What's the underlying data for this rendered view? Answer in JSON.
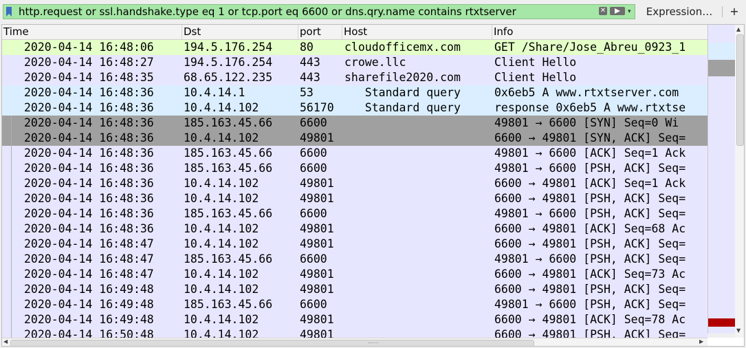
{
  "filter": {
    "value": "http.request or ssl.handshake.type eq 1 or tcp.port eq 6600 or dns.qry.name contains rtxtserver",
    "expression_label": "Expression…",
    "add_label": "+"
  },
  "columns": [
    "Time",
    "Dst",
    "port",
    "Host",
    "Info"
  ],
  "colors": {
    "http": "#e4ffc7",
    "default": "#e7e6ff",
    "dns": "#daeeff",
    "selected": "#a0a0a0",
    "filter_valid": "#a6e6a6",
    "minimap_marker": "#b00000"
  },
  "rows": [
    {
      "time": "2020-04-14 16:48:06",
      "dst": "194.5.176.254",
      "port": "80",
      "host": "cloudofficemx.com",
      "info": "GET /Share/Jose_Abreu_0923_1",
      "color": "http"
    },
    {
      "time": "2020-04-14 16:48:27",
      "dst": "194.5.176.254",
      "port": "443",
      "host": "crowe.llc",
      "info": "Client Hello",
      "color": "default"
    },
    {
      "time": "2020-04-14 16:48:35",
      "dst": "68.65.122.235",
      "port": "443",
      "host": "sharefile2020.com",
      "info": "Client Hello",
      "color": "default"
    },
    {
      "time": "2020-04-14 16:48:36",
      "dst": "10.4.14.1",
      "port": "53",
      "host": "   Standard query",
      "info": "0x6eb5 A www.rtxtserver.com",
      "color": "dns"
    },
    {
      "time": "2020-04-14 16:48:36",
      "dst": "10.4.14.102",
      "port": "56170",
      "host": "   Standard query",
      "info": "response 0x6eb5 A www.rtxtse",
      "color": "dns"
    },
    {
      "time": "2020-04-14 16:48:36",
      "dst": "185.163.45.66",
      "port": "6600",
      "host": "",
      "info": "49801 → 6600 [SYN] Seq=0 Wi",
      "color": "selected"
    },
    {
      "time": "2020-04-14 16:48:36",
      "dst": "10.4.14.102",
      "port": "49801",
      "host": "",
      "info": "6600 → 49801 [SYN, ACK] Seq=",
      "color": "selected"
    },
    {
      "time": "2020-04-14 16:48:36",
      "dst": "185.163.45.66",
      "port": "6600",
      "host": "",
      "info": "49801 → 6600 [ACK] Seq=1 Ack",
      "color": "default"
    },
    {
      "time": "2020-04-14 16:48:36",
      "dst": "185.163.45.66",
      "port": "6600",
      "host": "",
      "info": "49801 → 6600 [PSH, ACK] Seq=",
      "color": "default"
    },
    {
      "time": "2020-04-14 16:48:36",
      "dst": "10.4.14.102",
      "port": "49801",
      "host": "",
      "info": "6600 → 49801 [ACK] Seq=1 Ack",
      "color": "default"
    },
    {
      "time": "2020-04-14 16:48:36",
      "dst": "10.4.14.102",
      "port": "49801",
      "host": "",
      "info": "6600 → 49801 [PSH, ACK] Seq=",
      "color": "default"
    },
    {
      "time": "2020-04-14 16:48:36",
      "dst": "185.163.45.66",
      "port": "6600",
      "host": "",
      "info": "49801 → 6600 [PSH, ACK] Seq=",
      "color": "default"
    },
    {
      "time": "2020-04-14 16:48:36",
      "dst": "10.4.14.102",
      "port": "49801",
      "host": "",
      "info": "6600 → 49801 [ACK] Seq=68 Ac",
      "color": "default"
    },
    {
      "time": "2020-04-14 16:48:47",
      "dst": "10.4.14.102",
      "port": "49801",
      "host": "",
      "info": "6600 → 49801 [PSH, ACK] Seq=",
      "color": "default"
    },
    {
      "time": "2020-04-14 16:48:47",
      "dst": "185.163.45.66",
      "port": "6600",
      "host": "",
      "info": "49801 → 6600 [PSH, ACK] Seq=",
      "color": "default"
    },
    {
      "time": "2020-04-14 16:48:47",
      "dst": "10.4.14.102",
      "port": "49801",
      "host": "",
      "info": "6600 → 49801 [ACK] Seq=73 Ac",
      "color": "default"
    },
    {
      "time": "2020-04-14 16:49:48",
      "dst": "10.4.14.102",
      "port": "49801",
      "host": "",
      "info": "6600 → 49801 [PSH, ACK] Seq=",
      "color": "default"
    },
    {
      "time": "2020-04-14 16:49:48",
      "dst": "185.163.45.66",
      "port": "6600",
      "host": "",
      "info": "49801 → 6600 [PSH, ACK] Seq=",
      "color": "default"
    },
    {
      "time": "2020-04-14 16:49:48",
      "dst": "10.4.14.102",
      "port": "49801",
      "host": "",
      "info": "6600 → 49801 [ACK] Seq=78 Ac",
      "color": "default"
    },
    {
      "time": "2020-04-14 16:50:48",
      "dst": "10.4.14.102",
      "port": "49801",
      "host": "",
      "info": "6600 → 49801 [PSH, ACK] Seq=",
      "color": "default"
    }
  ]
}
